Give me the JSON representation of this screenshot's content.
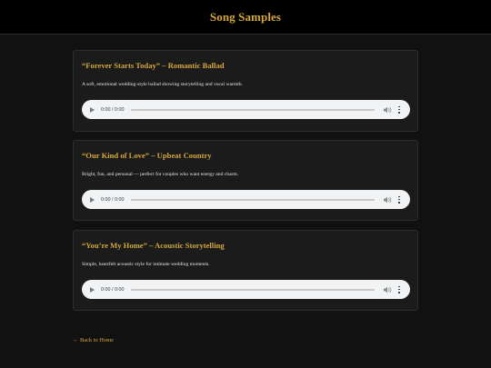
{
  "header": {
    "title": "Song Samples"
  },
  "samples": [
    {
      "title": "“Forever Starts Today” – Romantic Ballad",
      "description": "A soft, emotional wedding-style ballad showing storytelling and vocal warmth.",
      "player": {
        "time": "0:00 / 0:00",
        "progress": 0
      }
    },
    {
      "title": "“Our Kind of Love” – Upbeat Country",
      "description": "Bright, fun, and personal — perfect for couples who want energy and charm.",
      "player": {
        "time": "0:00 / 0:00",
        "progress": 0
      }
    },
    {
      "title": "“You’re My Home” – Acoustic Storytelling",
      "description": "Simple, heartfelt acoustic style for intimate wedding moments.",
      "player": {
        "time": "0:00 / 0:00",
        "progress": 0
      }
    }
  ],
  "footer": {
    "back_link": "← Back to Home"
  },
  "colors": {
    "accent": "#d4a73a",
    "background": "#111111",
    "header_background": "#000000",
    "card_background": "#1b1b1b",
    "player_background": "#f1f3f4"
  },
  "icons": {
    "play": "play-icon",
    "volume": "volume-icon",
    "menu": "vertical-dots-menu-icon"
  }
}
